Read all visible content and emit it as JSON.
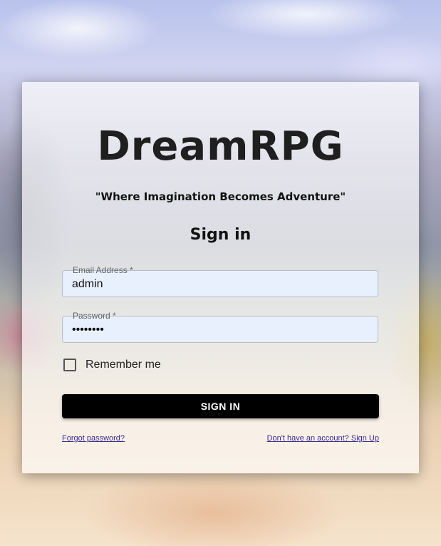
{
  "app": {
    "logo_text": "DreamRPG",
    "tagline": "\"Where Imagination Becomes Adventure\""
  },
  "form": {
    "heading": "Sign in",
    "email": {
      "label": "Email Address *",
      "value": "admin"
    },
    "password": {
      "label": "Password *",
      "masked_value": "••••••••"
    },
    "remember": {
      "label": "Remember me",
      "checked": false
    },
    "submit_label": "SIGN IN",
    "forgot_link": "Forgot password?",
    "signup_link": "Don't have an account? Sign Up"
  },
  "colors": {
    "button_bg": "#000000",
    "field_bg": "#e8f0fe",
    "link": "#3a2a8c"
  }
}
